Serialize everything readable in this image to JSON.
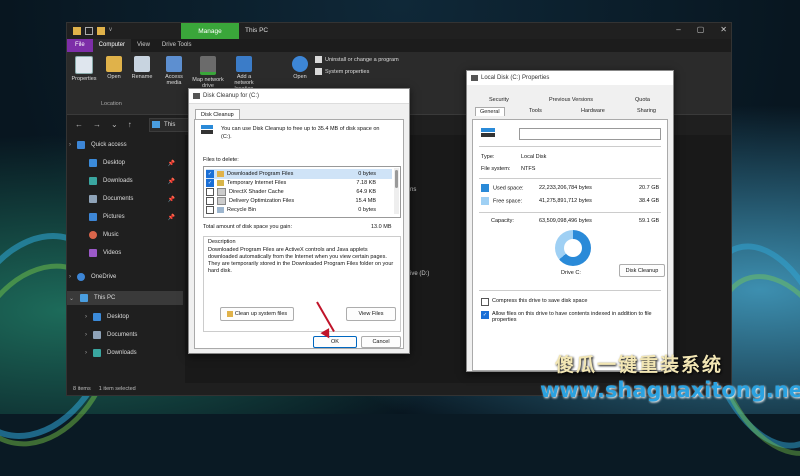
{
  "explorer": {
    "title": "This PC",
    "manage_tab": "Manage",
    "qa_arrow": "v",
    "ribbon_tabs": [
      "File",
      "Computer",
      "View",
      "Drive Tools"
    ],
    "ribbon_items": [
      "Properties",
      "Open",
      "Rename",
      "Access media",
      "Map network drive",
      "Add a network location",
      "Open"
    ],
    "ribbon_group": "Location",
    "ribbon_right": [
      "Uninstall or change a program",
      "System properties"
    ],
    "address_partial": "This",
    "sidebar": {
      "quick_access": "Quick access",
      "items": [
        "Desktop",
        "Downloads",
        "Documents",
        "Pictures",
        "Music",
        "Videos"
      ],
      "onedrive": "OneDrive",
      "this_pc": "This PC",
      "pc_items": [
        "Desktop",
        "Documents",
        "Downloads"
      ]
    },
    "main_partial": [
      "ns",
      "ive (D:)"
    ],
    "status": [
      "8 items",
      "1 item selected"
    ]
  },
  "disk_cleanup": {
    "title": "Disk Cleanup for  (C:)",
    "tab": "Disk Cleanup",
    "info": "You can use Disk Cleanup to free up to 35.4 MB of disk space on  (C:).",
    "files_label": "Files to delete:",
    "files": [
      {
        "name": "Downloaded Program Files",
        "size": "0 bytes",
        "checked": true
      },
      {
        "name": "Temporary Internet Files",
        "size": "7.18 KB",
        "checked": true
      },
      {
        "name": "DirectX Shader Cache",
        "size": "64.9 KB",
        "checked": false
      },
      {
        "name": "Delivery Optimization Files",
        "size": "15.4 MB",
        "checked": false
      },
      {
        "name": "Recycle Bin",
        "size": "0 bytes",
        "checked": false
      }
    ],
    "total_label": "Total amount of disk space you gain:",
    "total_value": "13.0 MB",
    "desc_label": "Description",
    "desc_text": "Downloaded Program Files are ActiveX controls and Java applets downloaded automatically from the Internet when you view certain pages. They are temporarily stored in the Downloaded Program Files folder on your hard disk.",
    "cleanup_btn": "Clean up system files",
    "view_btn": "View Files",
    "ok_btn": "OK",
    "cancel_btn": "Cancel"
  },
  "properties": {
    "title": "Local Disk (C:) Properties",
    "tabs_row1": [
      "Security",
      "Previous Versions",
      "Quota"
    ],
    "tabs_row2": [
      "General",
      "Tools",
      "Hardware",
      "Sharing"
    ],
    "type_label": "Type:",
    "type_value": "Local Disk",
    "fs_label": "File system:",
    "fs_value": "NTFS",
    "used_label": "Used space:",
    "used_bytes": "22,233,206,784 bytes",
    "used_gb": "20.7 GB",
    "free_label": "Free space:",
    "free_bytes": "41,275,891,712 bytes",
    "free_gb": "38.4 GB",
    "cap_label": "Capacity:",
    "cap_bytes": "63,509,098,496 bytes",
    "cap_gb": "59.1 GB",
    "drive_label": "Drive C:",
    "cleanup_btn": "Disk Cleanup",
    "compress": "Compress this drive to save disk space",
    "index": "Allow files on this drive to have contents indexed in addition to file properties",
    "used_color": "#2a8ad8",
    "free_color": "#9fd0f4"
  },
  "watermark": {
    "chinese": "傻瓜一键重装系统",
    "url": "www.shaguaxitong.net"
  }
}
